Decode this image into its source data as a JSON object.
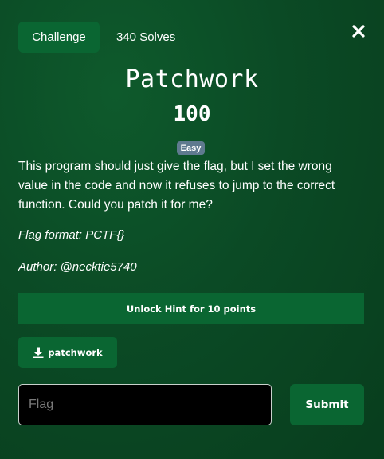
{
  "tabs": {
    "challenge_label": "Challenge",
    "solves_label": "340 Solves"
  },
  "challenge": {
    "name": "Patchwork",
    "points": "100",
    "difficulty": "Easy",
    "description": "This program should just give the flag, but I set the wrong value in the code and now it refuses to jump to the correct function. Could you patch it for me?",
    "flag_format": "Flag format: PCTF{}",
    "author": "Author: @necktie5740"
  },
  "hint": {
    "label": "Unlock Hint for 10 points"
  },
  "file": {
    "label": "patchwork",
    "icon": "download-icon"
  },
  "form": {
    "flag_placeholder": "Flag",
    "flag_value": "",
    "submit_label": "Submit"
  },
  "icons": {
    "close": "close-icon"
  },
  "colors": {
    "background": "#0b4a25",
    "button": "#0a6632",
    "badge": "#5f7a8f",
    "input_bg": "#000000"
  }
}
